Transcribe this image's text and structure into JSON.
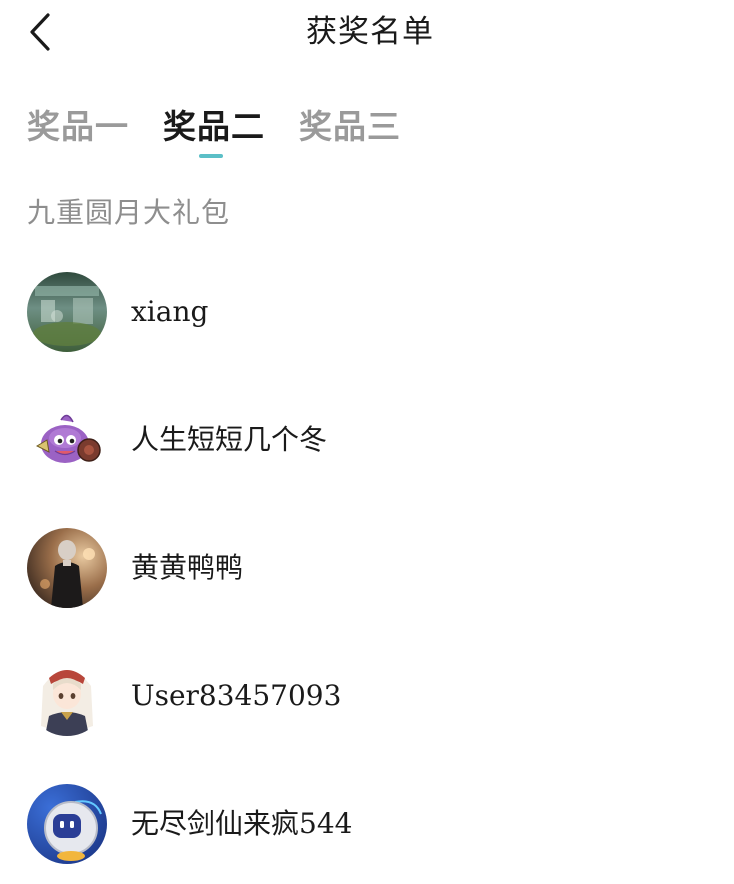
{
  "header": {
    "title": "获奖名单",
    "back_icon": "chevron-left-icon"
  },
  "tabs": [
    {
      "label": "奖品一",
      "active": false
    },
    {
      "label": "奖品二",
      "active": true
    },
    {
      "label": "奖品三",
      "active": false
    }
  ],
  "colors": {
    "accent": "#5bbfc7",
    "text_primary": "#1a1a1a",
    "text_secondary": "#9a9a9a"
  },
  "prize": {
    "name": "九重圆月大礼包"
  },
  "winners": [
    {
      "name": "xiang",
      "avatar": "landscape-avatar"
    },
    {
      "name": "人生短短几个冬",
      "avatar": "purple-creature-avatar"
    },
    {
      "name": "黄黄鸭鸭",
      "avatar": "figure-in-black-avatar"
    },
    {
      "name": "User83457093",
      "avatar": "anime-girl-avatar"
    },
    {
      "name": "无尽剑仙来疯544",
      "avatar": "robot-avatar"
    }
  ]
}
